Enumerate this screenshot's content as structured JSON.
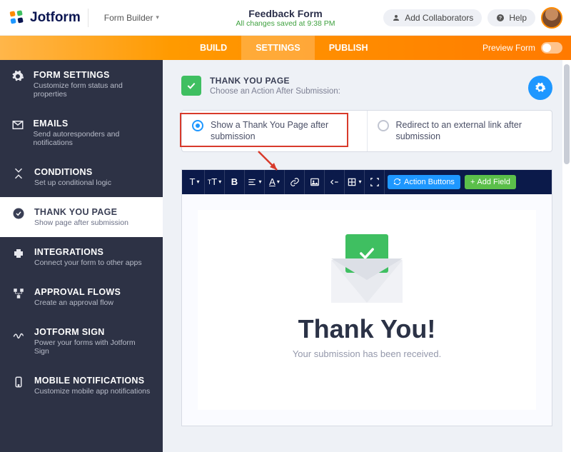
{
  "header": {
    "brand": "Jotform",
    "builder_label": "Form Builder",
    "form_title": "Feedback Form",
    "save_status": "All changes saved at 9:38 PM",
    "add_collab": "Add Collaborators",
    "help": "Help"
  },
  "nav": {
    "tabs": [
      "BUILD",
      "SETTINGS",
      "PUBLISH"
    ],
    "preview_label": "Preview Form"
  },
  "sidebar": {
    "items": [
      {
        "title": "FORM SETTINGS",
        "sub": "Customize form status and properties"
      },
      {
        "title": "EMAILS",
        "sub": "Send autoresponders and notifications"
      },
      {
        "title": "CONDITIONS",
        "sub": "Set up conditional logic"
      },
      {
        "title": "THANK YOU PAGE",
        "sub": "Show page after submission"
      },
      {
        "title": "INTEGRATIONS",
        "sub": "Connect your form to other apps"
      },
      {
        "title": "APPROVAL FLOWS",
        "sub": "Create an approval flow"
      },
      {
        "title": "JOTFORM SIGN",
        "sub": "Power your forms with Jotform Sign"
      },
      {
        "title": "MOBILE NOTIFICATIONS",
        "sub": "Customize mobile app notifications"
      }
    ]
  },
  "panel": {
    "title": "THANK YOU PAGE",
    "sub": "Choose an Action After Submission:",
    "option_a": "Show a Thank You Page after submission",
    "option_b": "Redirect to an external link after submission"
  },
  "toolbar": {
    "action_buttons": "Action Buttons",
    "add_field": "Add Field"
  },
  "thankyou": {
    "title": "Thank You!",
    "sub": "Your submission has been received."
  }
}
